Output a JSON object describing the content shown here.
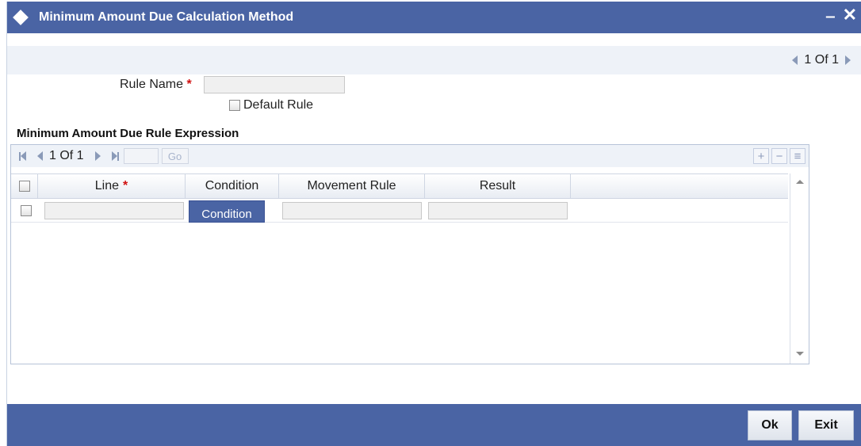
{
  "window": {
    "title": "Minimum Amount Due Calculation Method",
    "minimize_glyph": "‒",
    "close_glyph": "✕"
  },
  "record_pager": {
    "text": "1 Of 1"
  },
  "form": {
    "rule_name_label": "Rule Name",
    "required_marker": "*",
    "rule_name_value": "",
    "default_rule_label": "Default Rule",
    "default_rule_checked": false
  },
  "expression_section": {
    "title": "Minimum Amount Due Rule Expression",
    "pager_text": "1 Of 1",
    "go_label": "Go",
    "page_input_value": "",
    "add_glyph": "+",
    "delete_glyph": "−",
    "view_glyph": "≡",
    "columns": {
      "line": "Line",
      "condition": "Condition",
      "movement_rule": "Movement Rule",
      "result": "Result"
    },
    "rows": [
      {
        "line": "",
        "condition_button": "Condition",
        "movement_rule": "",
        "result": ""
      }
    ]
  },
  "footer": {
    "ok_label": "Ok",
    "exit_label": "Exit"
  },
  "colors": {
    "titlebar": "#4a64a4",
    "required": "#d01010",
    "panel_bg": "#eef2f8"
  }
}
